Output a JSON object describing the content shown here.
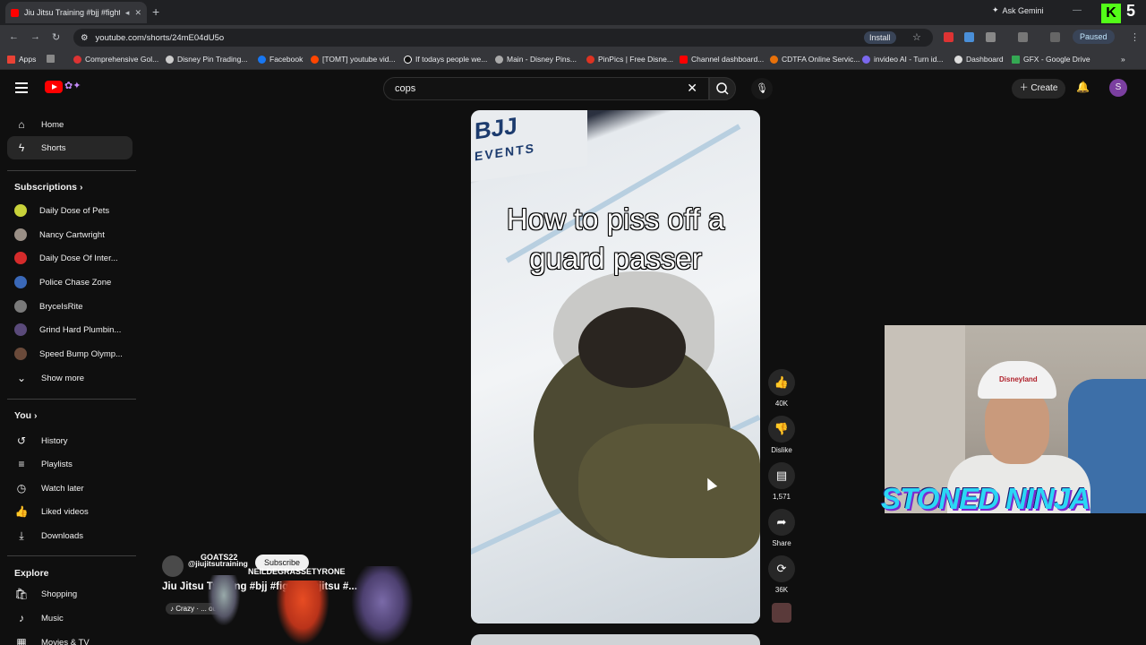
{
  "browser": {
    "tab_title": "Jiu Jitsu Training #bjj #fight",
    "ask_gemini": "Ask Gemini",
    "url": "youtube.com/shorts/24mE04dU5o",
    "install_label": "Install",
    "paused_label": "Paused",
    "kick_number": "5",
    "bookmarks": [
      "Apps",
      "Comprehensive Gol...",
      "Disney Pin Trading...",
      "Facebook",
      "[TOMT] youtube vid...",
      "If todays people we...",
      "Main - Disney Pins...",
      "PinPics | Free Disne...",
      "Channel dashboard...",
      "CDTFA Online Servic...",
      "invideo AI - Turn id...",
      "Dashboard",
      "GFX - Google Drive"
    ]
  },
  "youtube": {
    "search_value": "cops",
    "create_label": "Create",
    "avatar_letter": "S",
    "sidebar": {
      "main": [
        "Home",
        "Shorts"
      ],
      "subscriptions_header": "Subscriptions",
      "subscriptions": [
        "Daily Dose of Pets",
        "Nancy Cartwright",
        "Daily Dose Of Inter...",
        "Police Chase Zone",
        "BryceIsRite",
        "Grind Hard Plumbin...",
        "Speed Bump Olymp..."
      ],
      "show_more": "Show more",
      "you_header": "You",
      "you_items": [
        "History",
        "Playlists",
        "Watch later",
        "Liked videos",
        "Downloads"
      ],
      "explore_header": "Explore",
      "explore_items": [
        "Shopping",
        "Music",
        "Movies & TV"
      ]
    },
    "short": {
      "caption": "How to piss off a guard passer",
      "banner_text": "BJJ",
      "banner_sub": "EVENTS",
      "channel_handle": "@jiujitsutraining",
      "subscribe_label": "Subscribe",
      "title": "Jiu Jitsu Training #bjj #fight #jiujitsu #...",
      "music": "Crazy · ... ourne"
    },
    "actions": {
      "likes": "40K",
      "dislike": "Dislike",
      "comments": "1,571",
      "share": "Share",
      "remix": "36K"
    }
  },
  "overlay": {
    "goat_name": "GOATS22",
    "neil_name": "NEILDEGRASSETYRONE",
    "webcam_banner": "STONED NINJA",
    "hat_text": "Disneyland"
  },
  "colors": {
    "accent_red": "#ff0000",
    "webcam_text": "#2bd7f5"
  }
}
